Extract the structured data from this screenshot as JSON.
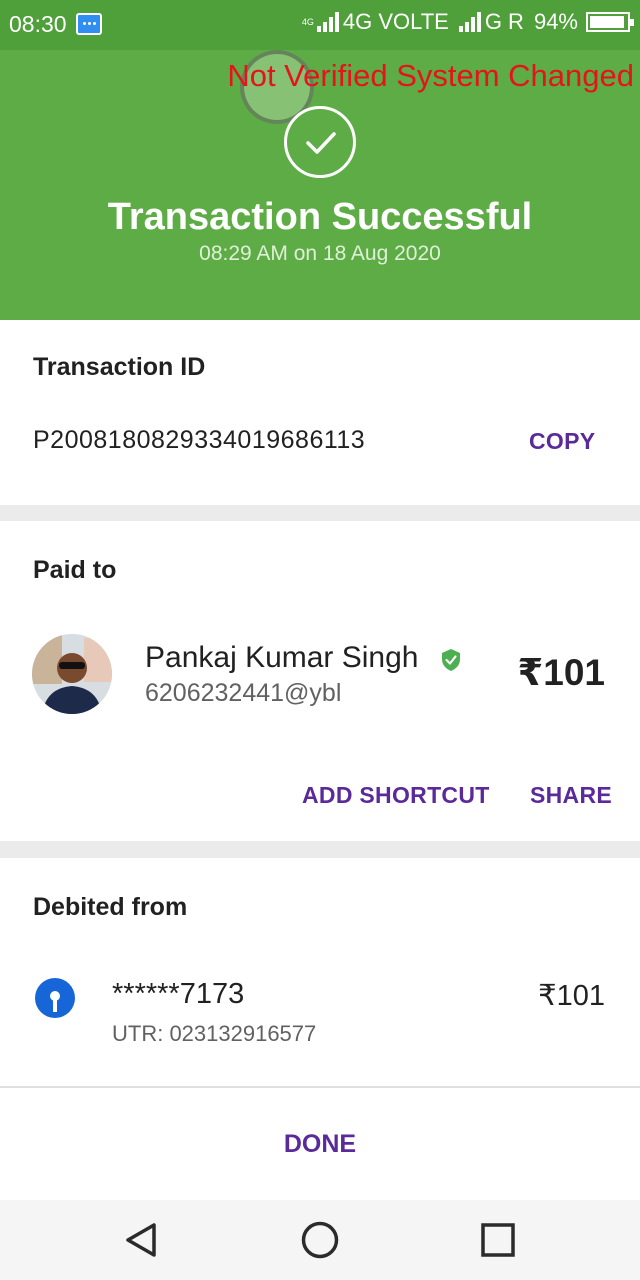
{
  "status_bar": {
    "time": "08:30",
    "network_small": "4G",
    "network_label": "4G VOLTE",
    "network2_label": "G R",
    "battery": "94%",
    "battery_level": 0.94
  },
  "header": {
    "watermark": "Not Verified System Changed",
    "title": "Transaction Successful",
    "subtitle": "08:29 AM on 18 Aug 2020",
    "background_color": "#5eac46"
  },
  "transaction": {
    "title": "Transaction ID",
    "id": "P2008180829334019686113",
    "copy_label": "COPY"
  },
  "paid_to": {
    "title": "Paid to",
    "name": "Pankaj Kumar Singh",
    "vpa": "6206232441@ybl",
    "amount": "₹101",
    "add_shortcut_label": "ADD SHORTCUT",
    "share_label": "SHARE"
  },
  "debited_from": {
    "title": "Debited from",
    "account": "******7173",
    "utr": "UTR: 023132916577",
    "amount": "₹101"
  },
  "done_label": "DONE",
  "icons": {
    "check": "check-circle-icon",
    "verified": "verified-shield-icon",
    "bank": "bank-logo-icon",
    "nav_back": "back-triangle-icon",
    "nav_home": "home-circle-icon",
    "nav_recents": "recents-square-icon"
  },
  "colors": {
    "accent": "#5b2a9a",
    "success": "#5eac46",
    "watermark": "#e5141a"
  }
}
